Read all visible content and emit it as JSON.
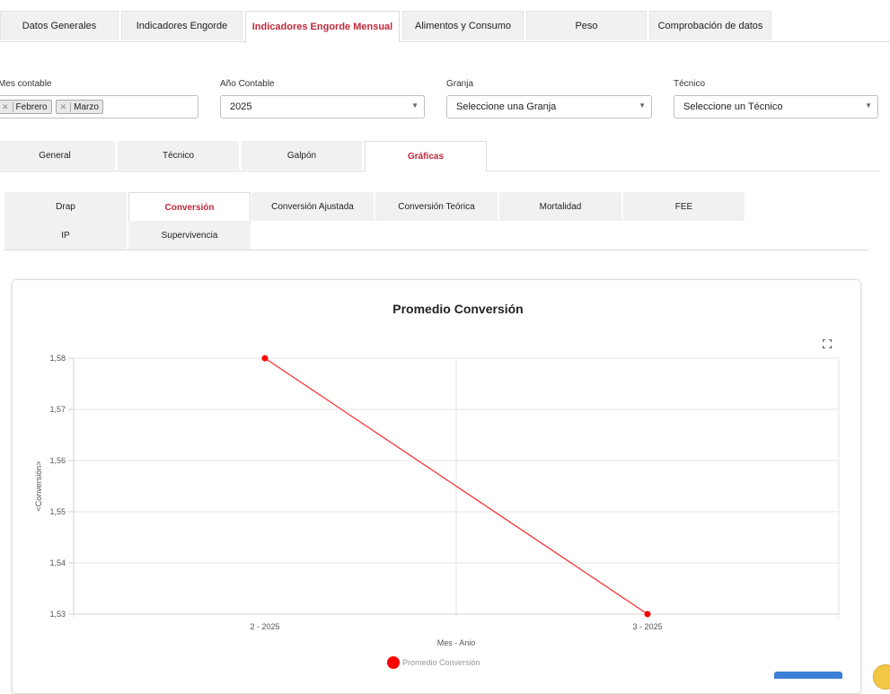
{
  "top_tabs": [
    {
      "label": "Datos Generales",
      "active": false
    },
    {
      "label": "Indicadores Engorde",
      "active": false
    },
    {
      "label": "Indicadores Engorde Mensual",
      "active": true
    },
    {
      "label": "Alimentos y Consumo",
      "active": false
    },
    {
      "label": "Peso",
      "active": false
    },
    {
      "label": "Comprobación de datos",
      "active": false
    }
  ],
  "filters": {
    "mes": {
      "label": "Mes contable",
      "chips": [
        "Febrero",
        "Marzo"
      ]
    },
    "anio": {
      "label": "Año Contable",
      "value": "2025"
    },
    "granja": {
      "label": "Granja",
      "value": "Seleccione una Granja"
    },
    "tecnico": {
      "label": "Técnico",
      "value": "Seleccione un Técnico"
    }
  },
  "section_tabs": [
    {
      "label": "General",
      "active": false
    },
    {
      "label": "Técnico",
      "active": false
    },
    {
      "label": "Galpón",
      "active": false
    },
    {
      "label": "Gráficas",
      "active": true
    }
  ],
  "chart_tabs": [
    {
      "label": "Drap",
      "active": false
    },
    {
      "label": "Conversión",
      "active": true
    },
    {
      "label": "Conversión Ajustada",
      "active": false
    },
    {
      "label": "Conversión Teórica",
      "active": false
    },
    {
      "label": "Mortalidad",
      "active": false
    },
    {
      "label": "FEE",
      "active": false
    },
    {
      "label": "IP",
      "active": false
    },
    {
      "label": "Supervivencia",
      "active": false
    }
  ],
  "icons": {
    "expand": "expand-icon",
    "remove": "close-icon",
    "dropdown": "chevron-down-icon"
  },
  "colors": {
    "accent": "#c0283a",
    "series": "#ff0000",
    "tab_bg": "#f1f1f1"
  },
  "chart_data": {
    "type": "line",
    "title": "Promedio Conversión",
    "xlabel": "Mes - Anio",
    "ylabel": "<Conversión>",
    "categories": [
      "2 - 2025",
      "3 - 2025"
    ],
    "series": [
      {
        "name": "Promedio Conversión",
        "values": [
          1.58,
          1.53
        ],
        "color": "#ff0000"
      }
    ],
    "ylim": [
      1.53,
      1.58
    ],
    "yticks": [
      "1,58",
      "1,57",
      "1,56",
      "1,55",
      "1,54",
      "1,53"
    ],
    "grid": true,
    "legend": "bottom"
  }
}
